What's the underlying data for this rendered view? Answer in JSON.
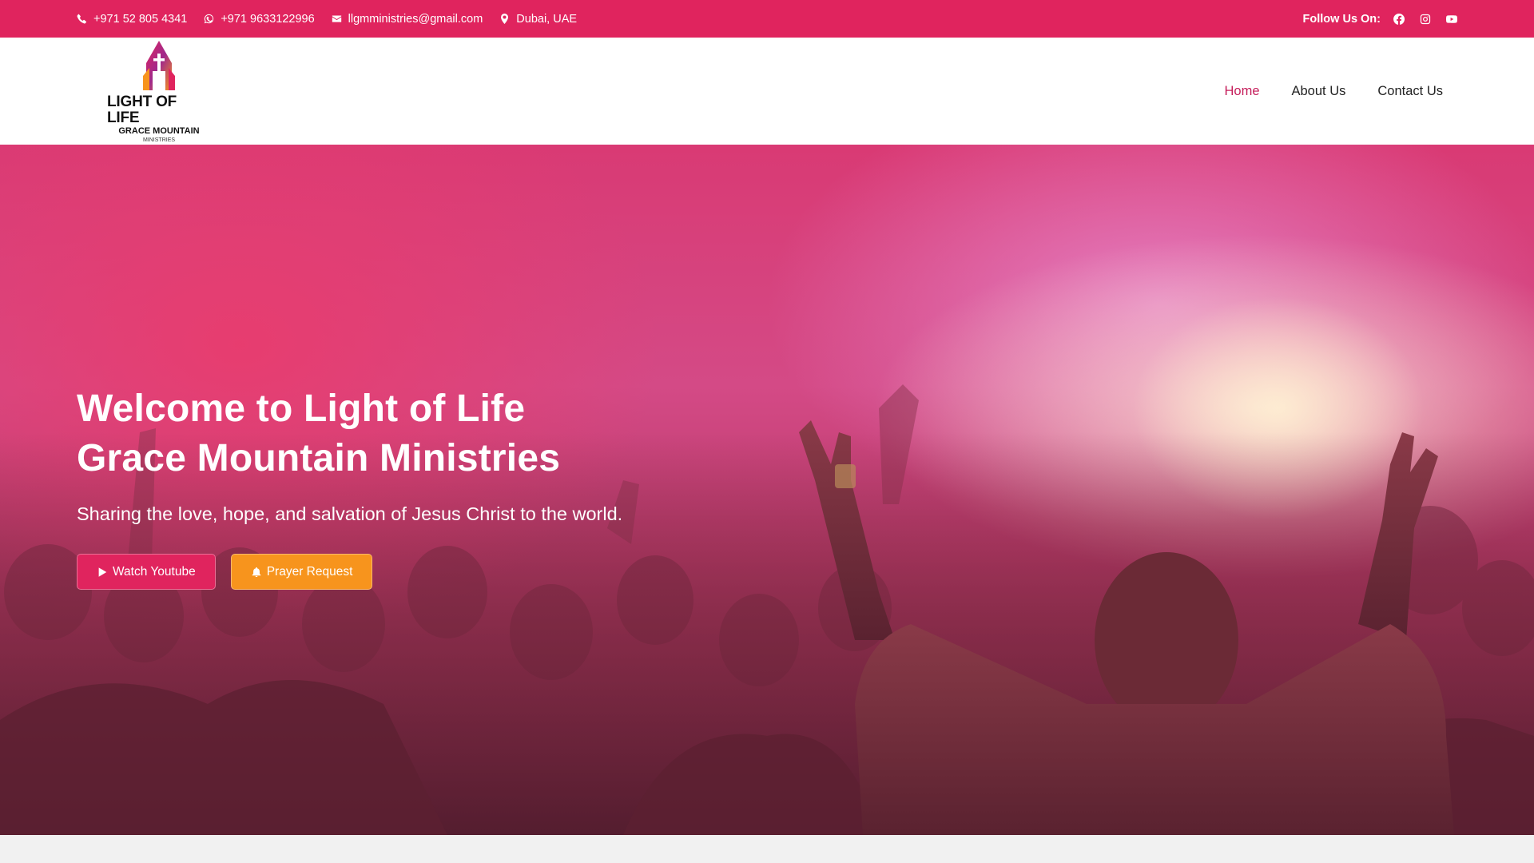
{
  "topbar": {
    "phone": "+971 52 805 4341",
    "whatsapp": "+971 9633122996",
    "email": "llgmministries@gmail.com",
    "location": "Dubai, UAE",
    "follow_label": "Follow Us On:",
    "social_icons": [
      "facebook-icon",
      "instagram-icon",
      "youtube-icon"
    ]
  },
  "logo": {
    "line1": "LIGHT OF LIFE",
    "line2": "GRACE MOUNTAIN",
    "line3": "MINISTRIES"
  },
  "nav": {
    "items": [
      "Home",
      "About Us",
      "Contact Us"
    ],
    "active": "Home"
  },
  "hero": {
    "title_line1": "Welcome to Light of Life",
    "title_line2": "Grace Mountain Ministries",
    "subtitle": "Sharing the love, hope, and salvation of Jesus Christ to the world.",
    "button_youtube": "Watch Youtube",
    "button_prayer": "Prayer Request"
  },
  "colors": {
    "brand_pink": "#e0245e",
    "accent_orange": "#f7941d",
    "nav_active": "#c51d5a"
  }
}
